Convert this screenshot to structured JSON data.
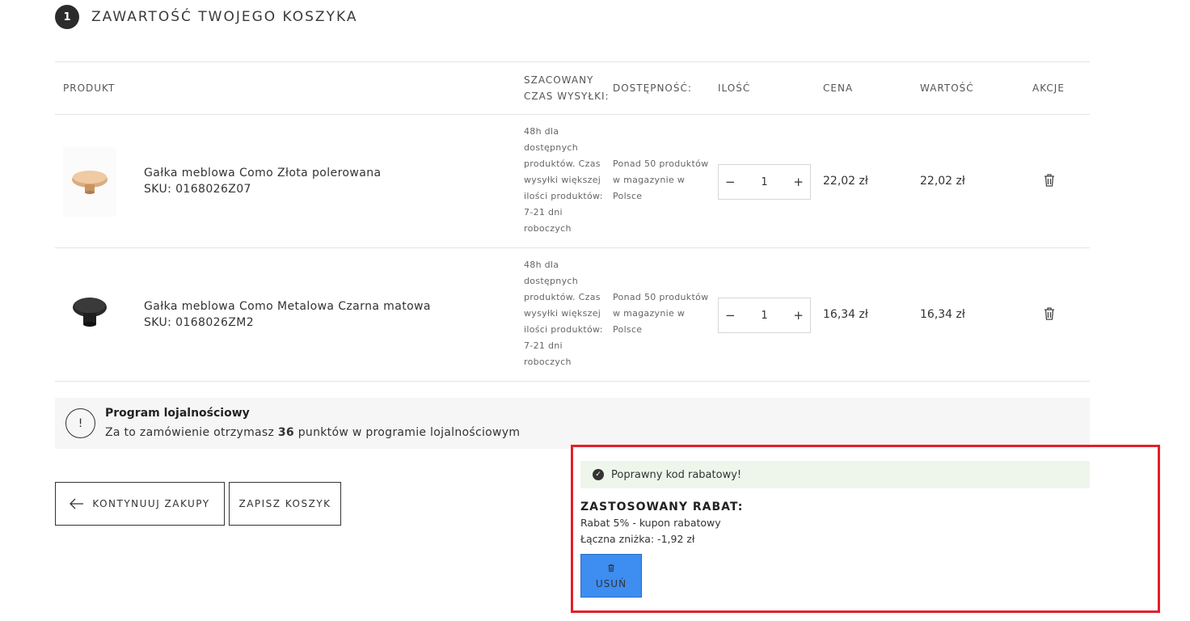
{
  "step": {
    "number": "1",
    "title": "ZAWARTOŚĆ TWOJEGO KOSZYKA"
  },
  "table": {
    "headers": {
      "product": "PRODUKT",
      "shipping_line1": "SZACOWANY",
      "shipping_line2": "CZAS WYSYŁKI:",
      "availability": "DOSTĘPNOŚĆ:",
      "quantity": "ILOŚĆ",
      "price": "CENA",
      "total": "WARTOŚĆ",
      "actions": "AKCJE"
    },
    "rows": [
      {
        "name": "Gałka meblowa Como Złota polerowana",
        "sku": "SKU: 0168026Z07",
        "shipping": [
          "48h dla",
          "dostępnych",
          "produktów. Czas",
          "wysyłki większej",
          "ilości produktów:",
          "7-21 dni",
          "roboczych"
        ],
        "availability": [
          "Ponad 50 produktów",
          "w magazynie w",
          "Polsce"
        ],
        "qty_minus": "−",
        "qty": "1",
        "qty_plus": "+",
        "price": "22,02 zł",
        "total": "22,02 zł",
        "image_color": "#e2b98f"
      },
      {
        "name": "Gałka meblowa Como Metalowa Czarna matowa",
        "sku": "SKU: 0168026ZM2",
        "shipping": [
          "48h dla",
          "dostępnych",
          "produktów. Czas",
          "wysyłki większej",
          "ilości produktów:",
          "7-21 dni",
          "roboczych"
        ],
        "availability": [
          "Ponad 50 produktów",
          "w magazynie w",
          "Polsce"
        ],
        "qty_minus": "−",
        "qty": "1",
        "qty_plus": "+",
        "price": "16,34 zł",
        "total": "16,34 zł",
        "image_color": "#1e1e1e"
      }
    ]
  },
  "loyalty": {
    "icon": "info-icon",
    "icon_glyph": "!",
    "title": "Program lojalnościowy",
    "text_before": "Za to zamówienie otrzymasz ",
    "points": "36",
    "text_after": " punktów w programie lojalnościowym"
  },
  "buttons": {
    "continue": "KONTYNUUJ ZAKUPY",
    "save_cart": "ZAPISZ KOSZYK"
  },
  "promo": {
    "success_msg": "Poprawny kod rabatowy!",
    "applied_title": "ZASTOSOWANY RABAT:",
    "discount_name": "Rabat 5% - kupon rabatowy",
    "total_discount": "Łączna zniżka: -1,92 zł",
    "remove_label": "USUŃ",
    "remove_button_color": "#3e8df0",
    "highlight_color": "#e3202a"
  }
}
